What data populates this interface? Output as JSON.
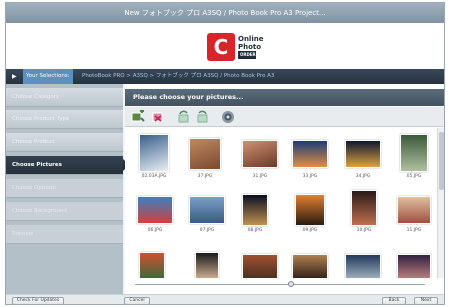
{
  "window": {
    "title": "New フォトブック プロ A3SQ / Photo Book Pro A3 Project..."
  },
  "logo": {
    "glyph": "C",
    "line1": "Online",
    "line2": "Photo",
    "line3": "ORDER"
  },
  "breadcrumb": {
    "label": "Your Selections:",
    "path": "PhotoBook PRO  >  A3SQ  >  フォトブック プロ A3SQ / Photo Book Pro A3"
  },
  "sidebar": {
    "items": [
      {
        "label": "Choose Category",
        "state": "done"
      },
      {
        "label": "Choose Product Type",
        "state": "done"
      },
      {
        "label": "Choose Product",
        "state": "done"
      },
      {
        "label": "Choose Pictures",
        "state": "active"
      },
      {
        "label": "Choose Options",
        "state": "pending"
      },
      {
        "label": "Choose Background",
        "state": "pending"
      },
      {
        "label": "Preview",
        "state": "pending"
      }
    ]
  },
  "main": {
    "header": "Please choose your pictures..."
  },
  "toolbar": {
    "icons": [
      "add-pictures-icon",
      "remove-picture-icon",
      "rotate-left-icon",
      "rotate-right-icon",
      "settings-icon"
    ]
  },
  "gallery": {
    "thumbnails": [
      {
        "caption": "02,03A.JPG",
        "c1": "#3a5f8a",
        "c2": "#e8eef4"
      },
      {
        "caption": "37.JPG",
        "c1": "#c08860",
        "c2": "#7a4a30"
      },
      {
        "caption": "31.JPG",
        "c1": "#d09070",
        "c2": "#6a3a2a"
      },
      {
        "caption": "33.JPG",
        "c1": "#1c3c7a",
        "c2": "#e09040"
      },
      {
        "caption": "34.JPG",
        "c1": "#0c1830",
        "c2": "#e0a040"
      },
      {
        "caption": "05.JPG",
        "c1": "#3a5a3a",
        "c2": "#b0c0a0"
      },
      {
        "caption": "06.JPG",
        "c1": "#3a80c0",
        "c2": "#d04040"
      },
      {
        "caption": "07.JPG",
        "c1": "#7aa0c8",
        "c2": "#3a5a80"
      },
      {
        "caption": "08.JPG",
        "c1": "#0a1020",
        "c2": "#c09050"
      },
      {
        "caption": "09.JPG",
        "c1": "#e08030",
        "c2": "#2a1a10"
      },
      {
        "caption": "10.JPG",
        "c1": "#2a1a18",
        "c2": "#c07050"
      },
      {
        "caption": "11.JPG",
        "c1": "#e0c0a0",
        "c2": "#a05040"
      },
      {
        "caption": "",
        "c1": "#d05030",
        "c2": "#3a6a3a"
      },
      {
        "caption": "",
        "c1": "#1a1a1a",
        "c2": "#d0b090"
      },
      {
        "caption": "",
        "c1": "#a05030",
        "c2": "#4a3020"
      },
      {
        "caption": "",
        "c1": "#b08050",
        "c2": "#302018"
      },
      {
        "caption": "",
        "c1": "#203a5a",
        "c2": "#a0b0c0"
      },
      {
        "caption": "",
        "c1": "#302040",
        "c2": "#c08080"
      }
    ]
  },
  "buttons": {
    "check_updates": "Check For Updates",
    "cancel": "Cancel",
    "back": "Back",
    "next": "Next"
  }
}
